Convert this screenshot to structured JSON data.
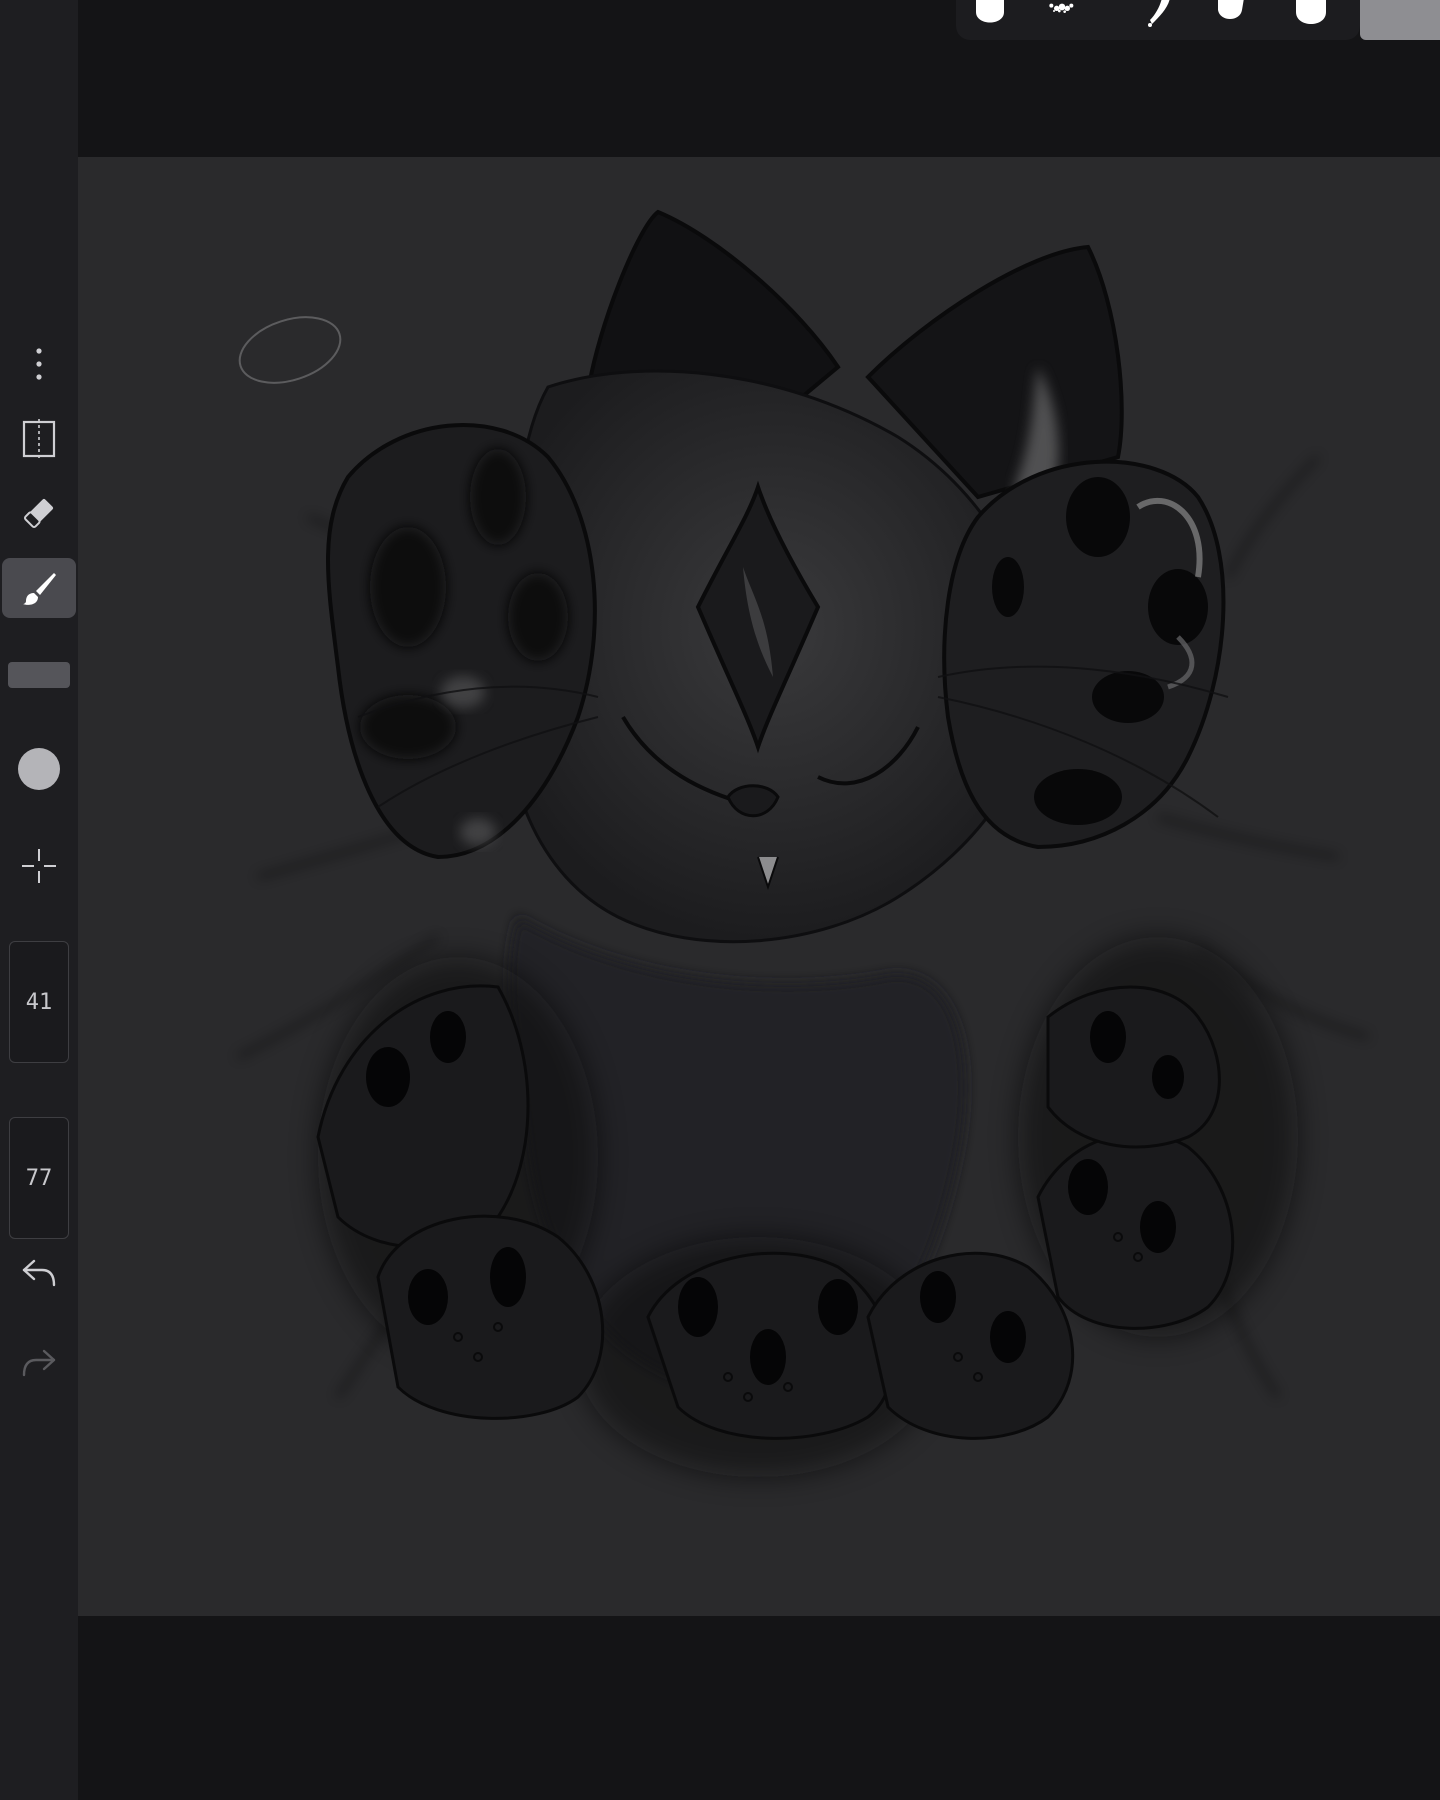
{
  "toolbar": {
    "more_icon": "more-vertical-icon",
    "selection_icon": "selection-icon",
    "eraser_icon": "eraser-icon",
    "brush_icon": "brush-icon",
    "transform_icon": "crosshair-icon",
    "undo_icon": "undo-icon",
    "redo_icon": "redo-icon",
    "active_tool": "brush",
    "brush_size": "41",
    "brush_opacity": "77"
  },
  "brushes": {
    "items": [
      "round-brush",
      "airbrush",
      "ink-brush",
      "round-brush-small",
      "round-brush-large"
    ],
    "color_swatch": "#8e8e92"
  },
  "canvas": {
    "subject": "creature-sketch",
    "background_color": "#2a2a2c"
  },
  "colors": {
    "sidebar_bg": "#1e1e21",
    "app_bg": "#141416",
    "active_tool_bg": "#4a4a4f",
    "canvas_bg": "#2a2a2c"
  }
}
